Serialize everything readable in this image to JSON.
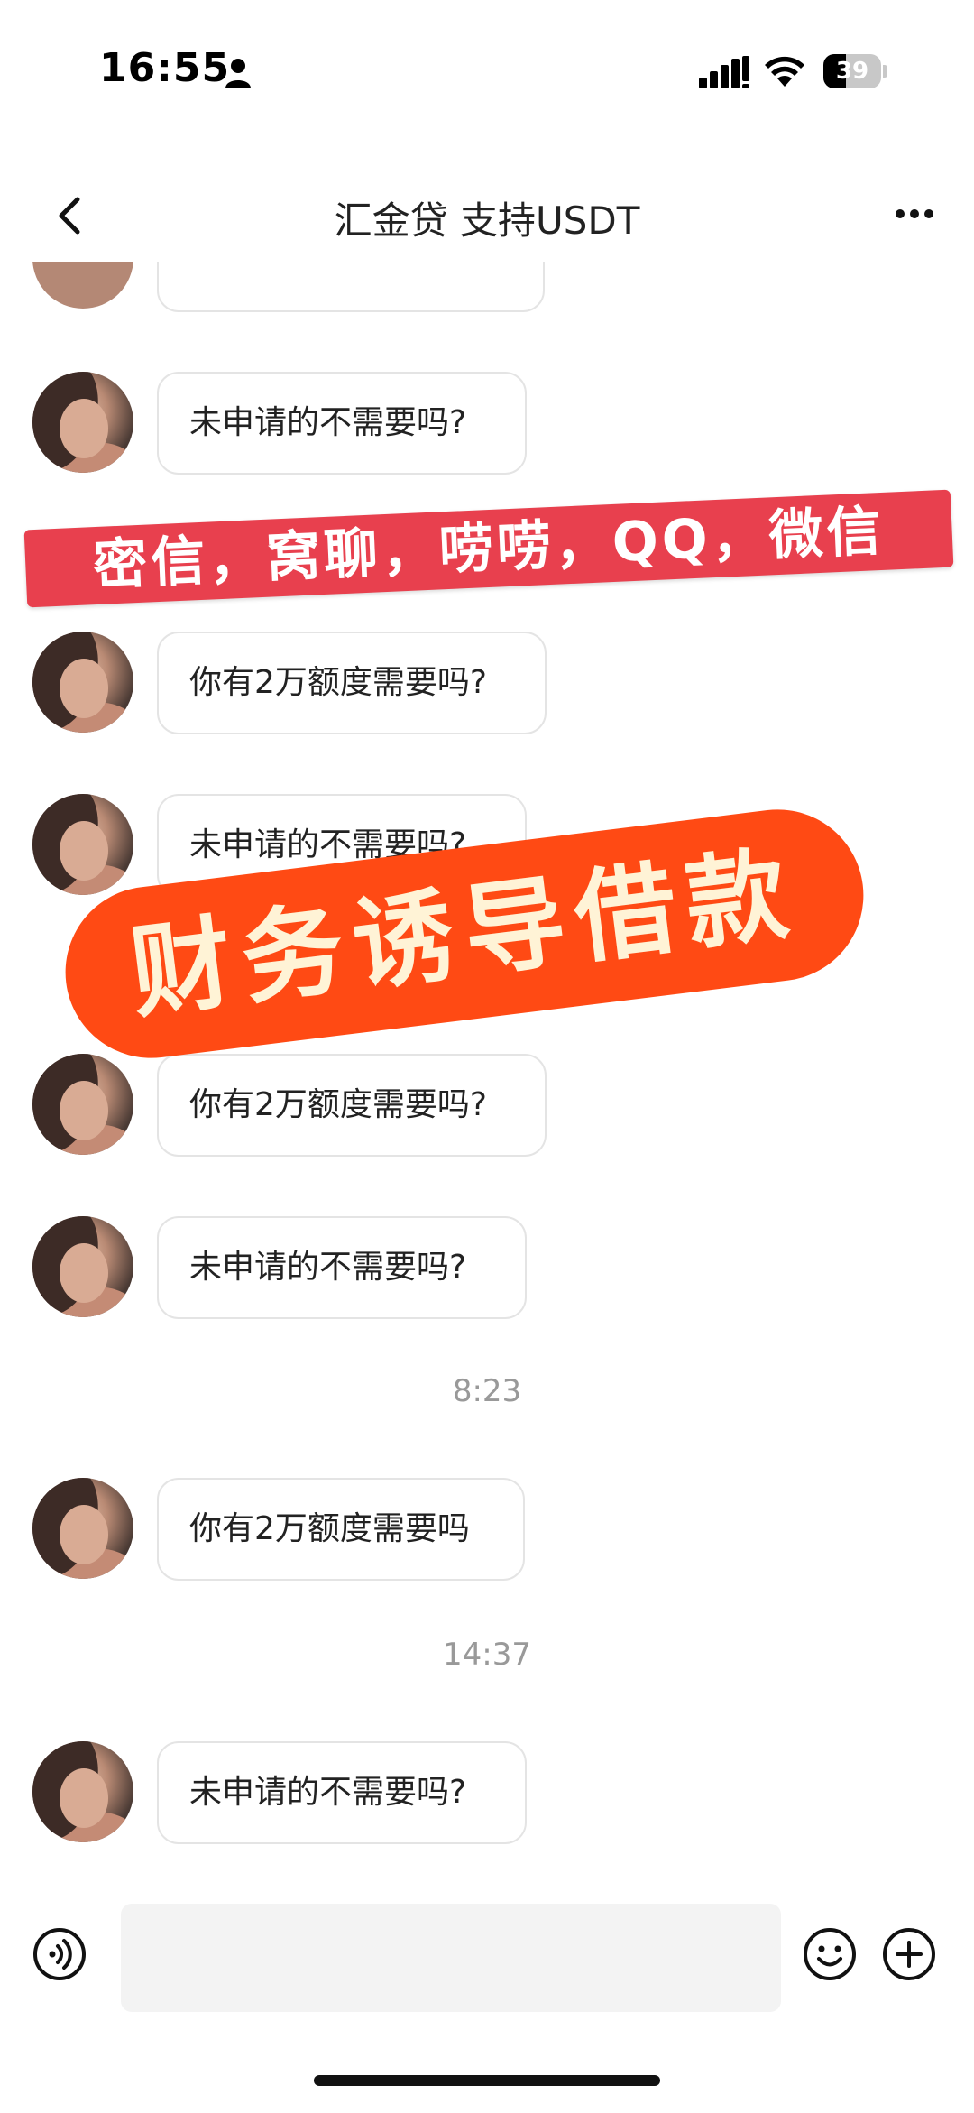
{
  "status_bar": {
    "time": "16:55",
    "battery_level": "39",
    "battery_fraction": 0.39
  },
  "nav": {
    "title": "汇金贷 支持USDT"
  },
  "messages": [
    {
      "type": "message",
      "text": "未申请的不需要吗?"
    },
    {
      "type": "message",
      "text": "你有2万额度需要吗?"
    },
    {
      "type": "message",
      "text": "未申请的不需要吗?"
    },
    {
      "type": "message",
      "text": "你有2万额度需要吗?"
    },
    {
      "type": "message",
      "text": "未申请的不需要吗?"
    },
    {
      "type": "timestamp",
      "text": "8:23"
    },
    {
      "type": "message",
      "text": "你有2万额度需要吗"
    },
    {
      "type": "timestamp",
      "text": "14:37"
    },
    {
      "type": "message",
      "text": "未申请的不需要吗?"
    }
  ],
  "overlays": {
    "red_banner": "密信，窝聊，唠唠，QQ，微信",
    "orange_banner": "财务诱导借款"
  },
  "icons": {
    "back": "chevron-left-icon",
    "more": "more-icon",
    "voice": "voice-icon",
    "emoji": "emoji-icon",
    "add": "add-icon",
    "person": "person-icon",
    "signal": "signal-icon",
    "wifi": "wifi-icon"
  },
  "colors": {
    "red_banner": "#e8404e",
    "orange_banner": "#ff4a14",
    "orange_text": "#fff3d6"
  }
}
